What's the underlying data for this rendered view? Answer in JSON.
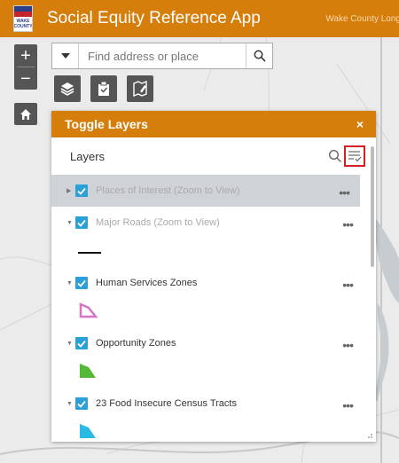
{
  "header": {
    "app_title": "Social Equity Reference App",
    "subtitle": "Wake County Long R",
    "logo_text": "WAKE COUNTY"
  },
  "map_controls": {
    "zoom_in": "+",
    "zoom_out": "−"
  },
  "search": {
    "placeholder": "Find address or place"
  },
  "panel": {
    "title": "Toggle Layers",
    "close_label": "×",
    "layers_label": "Layers",
    "layers": [
      {
        "name": "Places of Interest (Zoom to View)",
        "dimmed": true,
        "expanded": false,
        "checked": true
      },
      {
        "name": "Major Roads (Zoom to View)",
        "dimmed": true,
        "expanded": true,
        "checked": true
      },
      {
        "name": "Human Services Zones",
        "dimmed": false,
        "expanded": true,
        "checked": true
      },
      {
        "name": "Opportunity Zones",
        "dimmed": false,
        "expanded": true,
        "checked": true
      },
      {
        "name": "23 Food Insecure Census Tracts",
        "dimmed": false,
        "expanded": true,
        "checked": true
      }
    ],
    "more_label": "•••"
  },
  "colors": {
    "brand": "#d57e0b",
    "checkbox": "#2aa0d8",
    "filter_highlight": "#d01f27",
    "human_services": "#d675c6",
    "opportunity": "#55b936",
    "food_insecure": "#2bb9e6"
  }
}
